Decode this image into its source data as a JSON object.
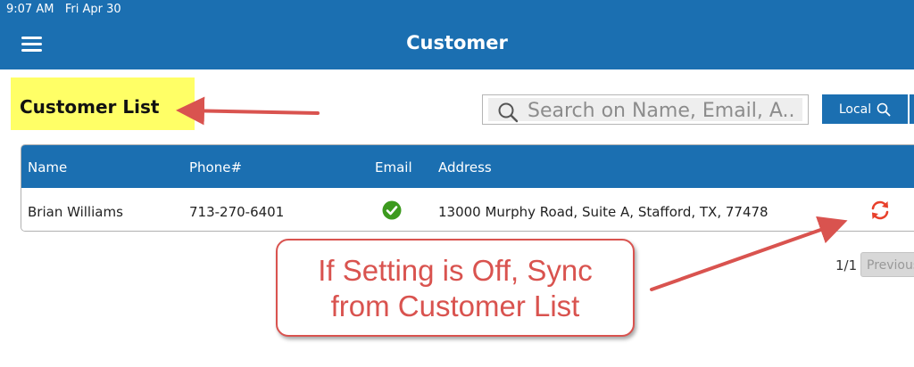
{
  "status_bar": {
    "time_date": "9:07 AM   Fri Apr 30"
  },
  "header": {
    "title": "Customer",
    "menu_icon": "hamburger-menu-icon"
  },
  "list": {
    "title": "Customer List"
  },
  "search": {
    "placeholder": "Search on Name, Email, A...",
    "icon": "search-icon",
    "scope_button_label": "Local"
  },
  "table": {
    "columns": [
      "Name",
      "Phone#",
      "Email",
      "Address"
    ],
    "rows": [
      {
        "name": "Brian Williams",
        "phone": "713-270-6401",
        "email_status": "check-circle-icon",
        "address": "13000 Murphy Road, Suite A, Stafford, TX, 77478",
        "action_icon": "sync-icon"
      }
    ]
  },
  "pagination": {
    "count": "1/1",
    "previous_label": "Previous"
  },
  "annotation": {
    "callout_line1": "If Setting is Off, Sync",
    "callout_line2": "from Customer List"
  },
  "colors": {
    "header_blue": "#1b6fb1",
    "highlight_yellow": "#ffff66",
    "annotation_red": "#d9534f",
    "check_green": "#3c9a1e",
    "sync_red": "#e8402b"
  }
}
